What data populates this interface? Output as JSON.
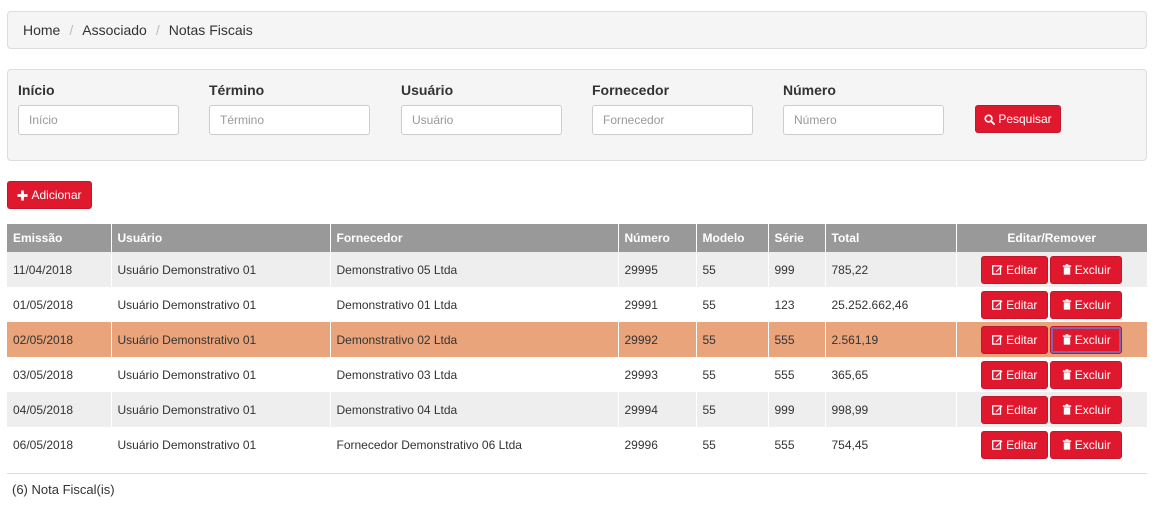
{
  "breadcrumb": {
    "items": [
      "Home",
      "Associado",
      "Notas Fiscais"
    ]
  },
  "filters": {
    "inicio": {
      "label": "Início",
      "placeholder": "Início"
    },
    "termino": {
      "label": "Término",
      "placeholder": "Término"
    },
    "usuario": {
      "label": "Usuário",
      "placeholder": "Usuário"
    },
    "fornecedor": {
      "label": "Fornecedor",
      "placeholder": "Fornecedor"
    },
    "numero": {
      "label": "Número",
      "placeholder": "Número"
    },
    "search_label": "Pesquisar"
  },
  "add_label": "Adicionar",
  "table": {
    "headers": [
      "Emissão",
      "Usuário",
      "Fornecedor",
      "Número",
      "Modelo",
      "Série",
      "Total",
      "Editar/Remover"
    ],
    "rows": [
      [
        "11/04/2018",
        "Usuário Demonstrativo 01",
        "Demonstrativo 05 Ltda",
        "29995",
        "55",
        "999",
        "785,22"
      ],
      [
        "01/05/2018",
        "Usuário Demonstrativo 01",
        "Demonstrativo 01 Ltda",
        "29991",
        "55",
        "123",
        "25.252.662,46"
      ],
      [
        "02/05/2018",
        "Usuário Demonstrativo 01",
        "Demonstrativo 02 Ltda",
        "29992",
        "55",
        "555",
        "2.561,19"
      ],
      [
        "03/05/2018",
        "Usuário Demonstrativo 01",
        "Demonstrativo 03 Ltda",
        "29993",
        "55",
        "555",
        "365,65"
      ],
      [
        "04/05/2018",
        "Usuário Demonstrativo 01",
        "Demonstrativo 04 Ltda",
        "29994",
        "55",
        "999",
        "998,99"
      ],
      [
        "06/05/2018",
        "Usuário Demonstrativo 01",
        "Fornecedor Demonstrativo 06 Ltda",
        "29996",
        "55",
        "555",
        "754,45"
      ]
    ],
    "edit_label": "Editar",
    "delete_label": "Excluir"
  },
  "count_text": "(6) Nota Fiscal(is)",
  "colors": {
    "accent": "#e0182e",
    "header_bg": "#999999",
    "selected_row": "#eaa47c",
    "stripe": "#eeeeee"
  },
  "icons": {
    "search": "search-icon",
    "add": "plus-icon",
    "edit": "edit-icon",
    "delete": "trash-icon"
  }
}
